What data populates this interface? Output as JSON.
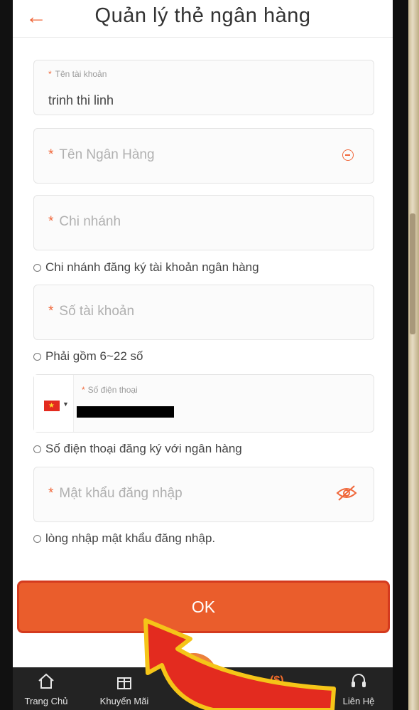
{
  "header": {
    "title": "Quản lý thẻ ngân hàng",
    "back_icon": "arrow-left-icon"
  },
  "form": {
    "account_name": {
      "label": "Tên tài khoản",
      "value": "trinh thi linh"
    },
    "bank_name": {
      "placeholder": "Tên Ngân Hàng"
    },
    "branch": {
      "placeholder": "Chi nhánh",
      "hint": "Chi nhánh đăng ký tài khoản ngân hàng"
    },
    "account_number": {
      "placeholder": "Số tài khoản",
      "hint": "Phải gồm 6~22 số"
    },
    "phone": {
      "label": "Số điện thoại",
      "hint": "Số điện thoại đăng ký với ngân hàng"
    },
    "password": {
      "placeholder": "Mật khẩu đăng nhập",
      "hint": "lòng nhập mật khẩu đăng nhập."
    }
  },
  "ok_button": {
    "label": "OK"
  },
  "tabbar": {
    "items": [
      {
        "label": "Trang Chủ",
        "icon": "home-icon"
      },
      {
        "label": "Khuyến Mãi",
        "icon": "gift-icon"
      },
      {
        "label": "",
        "icon": "money-icon"
      },
      {
        "label": "Liên Hệ",
        "icon": "headset-icon"
      }
    ]
  },
  "colors": {
    "accent": "#ea5d2c",
    "arrow": "#e32b1f",
    "tabbar_bg": "#232323"
  }
}
